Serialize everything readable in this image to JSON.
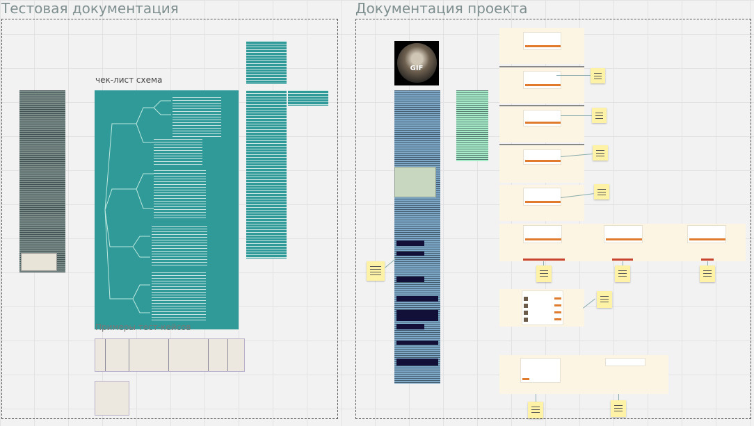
{
  "frames": [
    {
      "id": "test-docs",
      "title": "Тестовая документация"
    },
    {
      "id": "project-docs",
      "title": "Документация проекта"
    }
  ],
  "labels": {
    "checklist": "чек-лист схема",
    "test_cases": "Примеры тест-кейсов"
  },
  "gif": {
    "text": "GIF"
  },
  "colors": {
    "teal": "#2f9a98",
    "gray_doc": "#7a8c88",
    "blue_doc": "#7ea8c8",
    "mint": "#a7ecc8",
    "cream": "#fdf5e3",
    "sticky": "#fdf2a6",
    "accent_orange": "#e07a2c",
    "accent_red": "#c8432e"
  },
  "icons": [
    "gif-thumbnail",
    "sticky-note"
  ]
}
